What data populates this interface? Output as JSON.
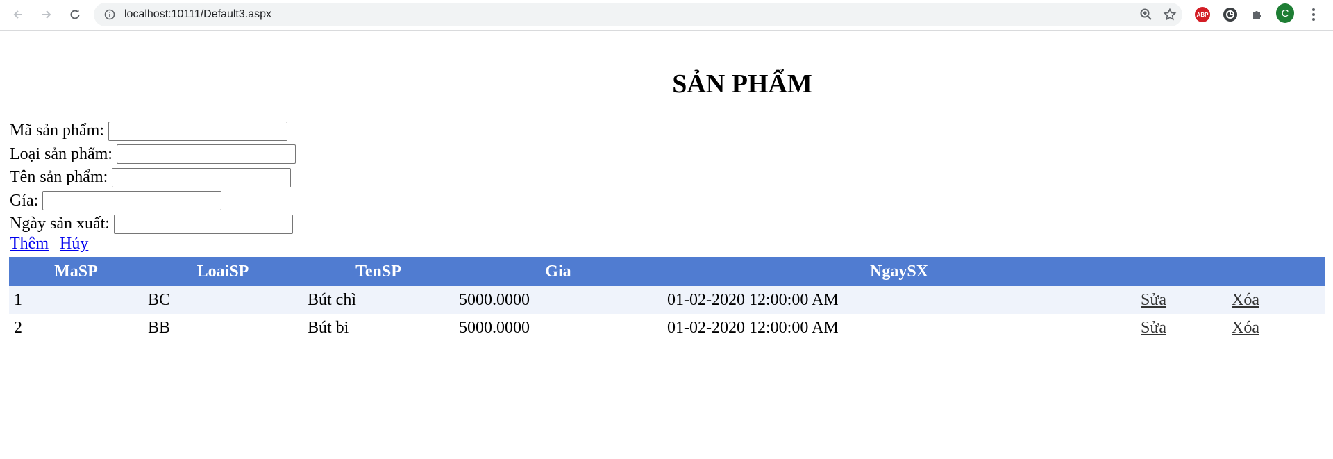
{
  "browser": {
    "url": "localhost:10111/Default3.aspx",
    "abp_label": "ABP",
    "avatar_letter": "C"
  },
  "page": {
    "title": "SẢN PHẨM"
  },
  "form": {
    "ma_label": "Mã sản phẩm:",
    "loai_label": "Loại sản phẩm:",
    "ten_label": "Tên sản phẩm:",
    "gia_label": "Gía:",
    "ngay_label": "Ngày sản xuất:",
    "ma_value": "",
    "loai_value": "",
    "ten_value": "",
    "gia_value": "",
    "ngay_value": ""
  },
  "actions": {
    "add_label": "Thêm",
    "cancel_label": "Hủy"
  },
  "table": {
    "headers": [
      "MaSP",
      "LoaiSP",
      "TenSP",
      "Gia",
      "NgaySX",
      "",
      ""
    ],
    "rows": [
      {
        "masp": "1",
        "loaisp": "BC",
        "tensp": "Bút chì",
        "gia": "5000.0000",
        "ngaysx": "01-02-2020 12:00:00 AM",
        "edit": "Sửa",
        "delete": "Xóa"
      },
      {
        "masp": "2",
        "loaisp": "BB",
        "tensp": "Bút bi",
        "gia": "5000.0000",
        "ngaysx": "01-02-2020 12:00:00 AM",
        "edit": "Sửa",
        "delete": "Xóa"
      }
    ]
  },
  "colors": {
    "header_bg": "#507cd1",
    "row_alt_bg": "#eff3fb",
    "link": "#0000ee"
  }
}
